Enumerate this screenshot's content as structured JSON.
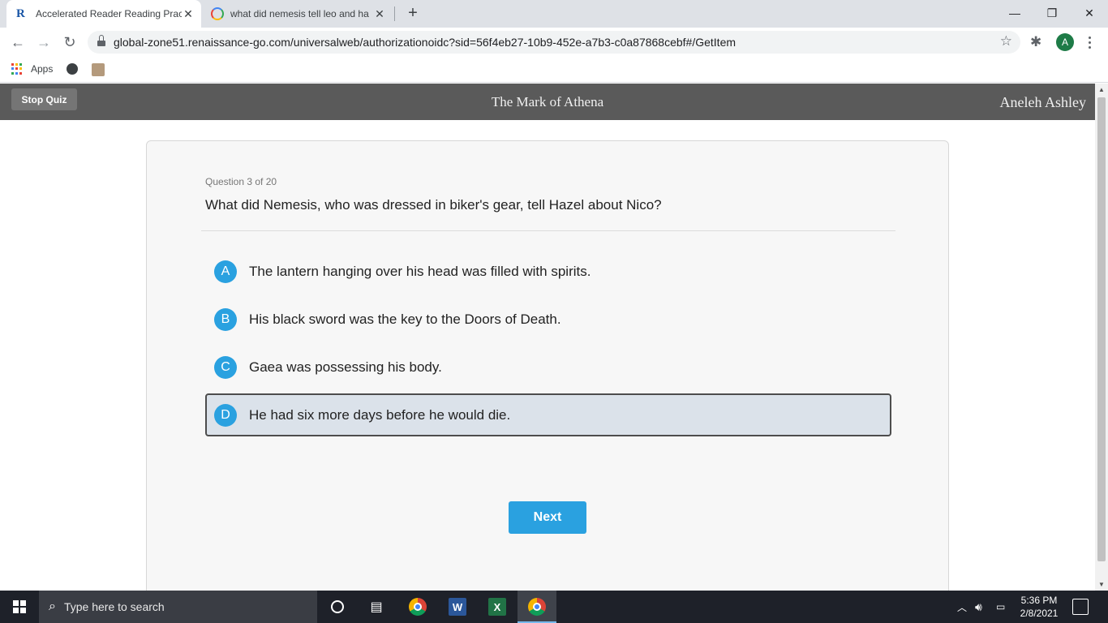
{
  "browser": {
    "tabs": [
      {
        "title": "Accelerated Reader Reading Prac",
        "active": true
      },
      {
        "title": "what did nemesis tell leo and ha",
        "active": false
      }
    ],
    "url": "global-zone51.renaissance-go.com/universalweb/authorizationoidc?sid=56f4eb27-10b9-452e-a7b3-c0a87868cebf#/GetItem",
    "profile_initial": "A",
    "bookmarks": {
      "apps_label": "Apps"
    }
  },
  "quiz_header": {
    "stop_label": "Stop Quiz",
    "book_title": "The Mark of Athena",
    "student_name": "Aneleh Ashley"
  },
  "question": {
    "number_label": "Question 3 of 20",
    "text": "What did Nemesis, who was dressed in biker's gear, tell Hazel about Nico?",
    "options": [
      {
        "letter": "A",
        "text": "The lantern hanging over his head was filled with spirits."
      },
      {
        "letter": "B",
        "text": "His black sword was the key to the Doors of Death."
      },
      {
        "letter": "C",
        "text": "Gaea was possessing his body."
      },
      {
        "letter": "D",
        "text": "He had six more days before he would die."
      }
    ],
    "selected": "D"
  },
  "next_label": "Next",
  "taskbar": {
    "search_placeholder": "Type here to search",
    "time": "5:36 PM",
    "date": "2/8/2021"
  },
  "colors": {
    "accent": "#2aa1e0",
    "header_bar": "#5a5a5a",
    "selected_bg": "#dbe2ea"
  }
}
